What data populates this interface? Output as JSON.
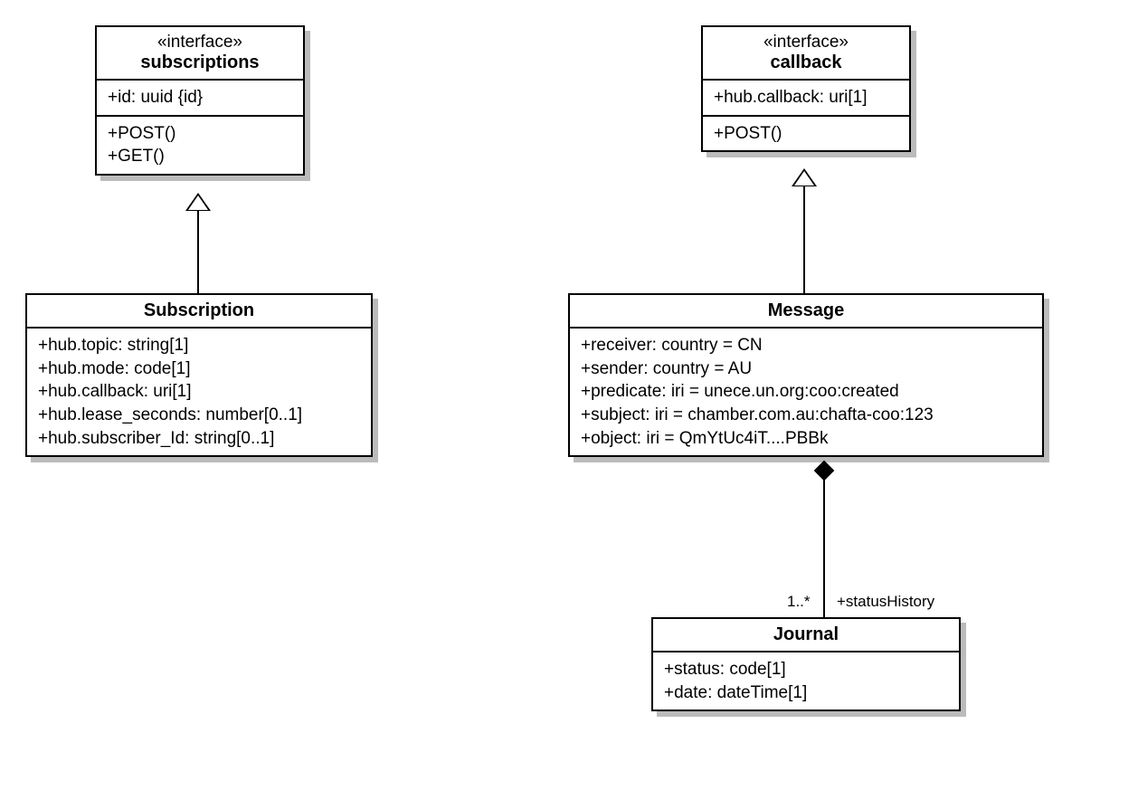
{
  "chart_data": {
    "type": "uml_class_diagram",
    "classes": [
      {
        "id": "subscriptions",
        "stereotype": "«interface»",
        "name": "subscriptions",
        "attributes": [
          "+id: uuid {id}"
        ],
        "operations": [
          "+POST()",
          "+GET()"
        ]
      },
      {
        "id": "callback",
        "stereotype": "«interface»",
        "name": "callback",
        "attributes": [
          "+hub.callback: uri[1]"
        ],
        "operations": [
          "+POST()"
        ]
      },
      {
        "id": "Subscription",
        "name": "Subscription",
        "attributes": [
          "+hub.topic: string[1]",
          "+hub.mode: code[1]",
          "+hub.callback: uri[1]",
          "+hub.lease_seconds: number[0..1]",
          "+hub.subscriber_Id: string[0..1]"
        ]
      },
      {
        "id": "Message",
        "name": "Message",
        "attributes": [
          "+receiver: country = CN",
          "+sender: country = AU",
          "+predicate: iri = unece.un.org:coo:created",
          "+subject: iri = chamber.com.au:chafta-coo:123",
          "+object: iri = QmYtUc4iT....PBBk"
        ]
      },
      {
        "id": "Journal",
        "name": "Journal",
        "attributes": [
          "+status: code[1]",
          "+date: dateTime[1]"
        ]
      }
    ],
    "relationships": [
      {
        "type": "realization",
        "from": "Subscription",
        "to": "subscriptions"
      },
      {
        "type": "realization",
        "from": "Message",
        "to": "callback"
      },
      {
        "type": "composition",
        "whole": "Message",
        "part": "Journal",
        "role": "statusHistory",
        "multiplicity": "1..*"
      }
    ]
  },
  "boxes": {
    "subscriptions": {
      "stereo": "«interface»",
      "name": "subscriptions",
      "attrs": {
        "r0": "+id: uuid {id}"
      },
      "ops": {
        "r0": "+POST()",
        "r1": "+GET()"
      }
    },
    "callback": {
      "stereo": "«interface»",
      "name": "callback",
      "attrs": {
        "r0": "+hub.callback: uri[1]"
      },
      "ops": {
        "r0": "+POST()"
      }
    },
    "subscription": {
      "name": "Subscription",
      "attrs": {
        "r0": "+hub.topic: string[1]",
        "r1": "+hub.mode: code[1]",
        "r2": "+hub.callback: uri[1]",
        "r3": "+hub.lease_seconds: number[0..1]",
        "r4": "+hub.subscriber_Id: string[0..1]"
      }
    },
    "message": {
      "name": "Message",
      "attrs": {
        "r0": "+receiver: country = CN",
        "r1": "+sender: country = AU",
        "r2": "+predicate: iri = unece.un.org:coo:created",
        "r3": "+subject: iri = chamber.com.au:chafta-coo:123",
        "r4": "+object: iri = QmYtUc4iT....PBBk"
      }
    },
    "journal": {
      "name": "Journal",
      "attrs": {
        "r0": "+status: code[1]",
        "r1": "+date: dateTime[1]"
      }
    }
  },
  "labels": {
    "assoc_role": "+statusHistory",
    "assoc_mult": "1..*"
  }
}
